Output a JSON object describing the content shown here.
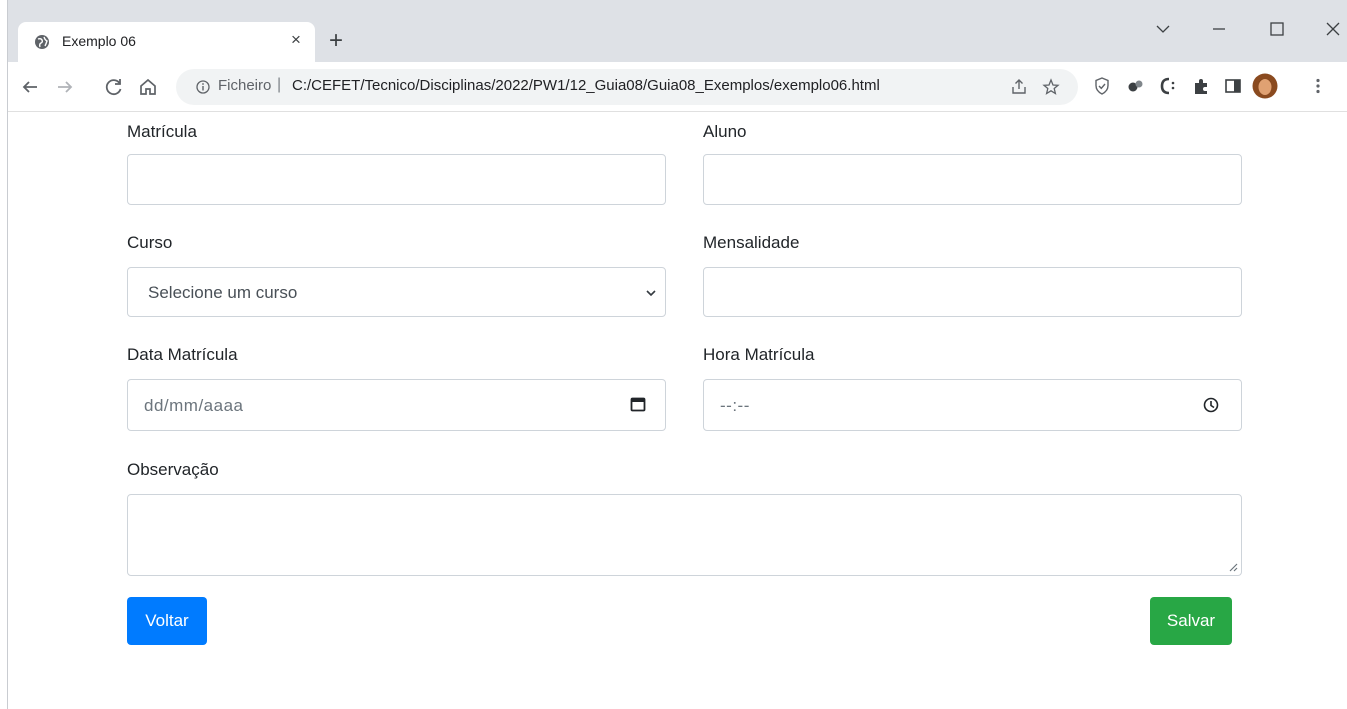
{
  "browser": {
    "tab": {
      "title": "Exemplo 06",
      "close_glyph": "×",
      "favicon": "globe-icon"
    },
    "new_tab_glyph": "+",
    "omnibox": {
      "scheme_label": "Ficheiro",
      "separator": "|",
      "url": "C:/CEFET/Tecnico/Disciplinas/2022/PW1/12_Guia08/Guia08_Exemplos/exemplo06.html"
    }
  },
  "form": {
    "matricula": {
      "label": "Matrícula",
      "value": ""
    },
    "aluno": {
      "label": "Aluno",
      "value": ""
    },
    "curso": {
      "label": "Curso",
      "selected": "Selecione um curso"
    },
    "mensalidade": {
      "label": "Mensalidade",
      "value": ""
    },
    "data_matricula": {
      "label": "Data Matrícula",
      "placeholder": "dd/mm/aaaa"
    },
    "hora_matricula": {
      "label": "Hora Matrícula",
      "placeholder": "--:--"
    },
    "observacao": {
      "label": "Observação",
      "value": ""
    },
    "buttons": {
      "voltar": "Voltar",
      "salvar": "Salvar"
    }
  },
  "colors": {
    "primary": "#007bff",
    "success": "#28a745",
    "border": "#ced4da",
    "tabstrip": "#dee1e6"
  }
}
